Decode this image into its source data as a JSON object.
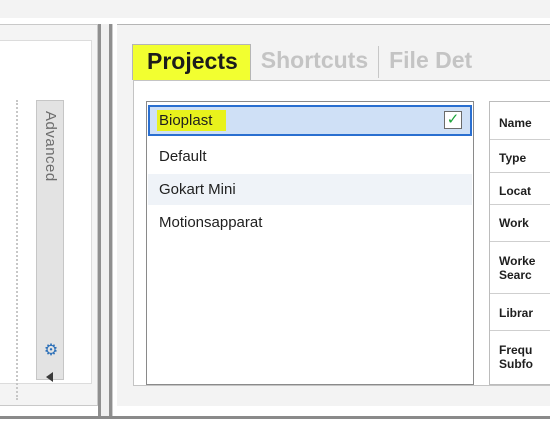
{
  "left_panel": {
    "advanced_tab_label": "Advanced",
    "gear_icon": "gear-icon",
    "collapse_icon": "arrow-left-icon"
  },
  "tabs": [
    {
      "label": "Projects",
      "active": true
    },
    {
      "label": "Shortcuts",
      "active": false
    },
    {
      "label": "File Det",
      "active": false
    }
  ],
  "projects": [
    {
      "name": "Bioplast",
      "selected": true,
      "checked": true
    },
    {
      "name": "Default",
      "selected": false,
      "checked": false
    },
    {
      "name": "Gokart Mini",
      "selected": false,
      "checked": false
    },
    {
      "name": "Motionsapparat",
      "selected": false,
      "checked": false
    }
  ],
  "properties": [
    {
      "label": "Name"
    },
    {
      "label": "Type"
    },
    {
      "label": "Locat"
    },
    {
      "label": "Work"
    },
    {
      "label": "Worke",
      "label2": "Searc"
    },
    {
      "label": "Librar"
    },
    {
      "label": "Frequ",
      "label2": "Subfo"
    }
  ],
  "colors": {
    "highlight": "#f2ff30",
    "selection_border": "#2a6fd0",
    "selection_fill": "#cfe0f6",
    "check_green": "#1aa33a"
  }
}
